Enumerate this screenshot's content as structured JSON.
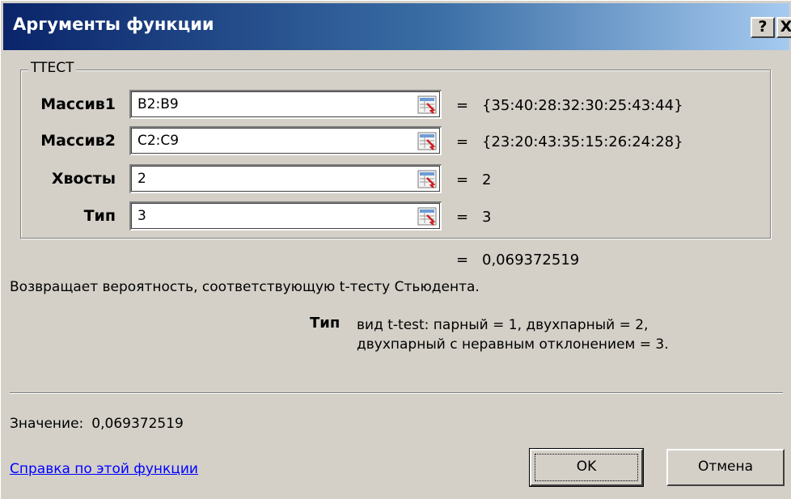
{
  "window": {
    "title": "Аргументы функции",
    "help_label": "?",
    "close_label": "X"
  },
  "function": {
    "name": "TTECT",
    "args": [
      {
        "label": "Массив1",
        "value": "B2:B9",
        "result": "{35:40:28:32:30:25:43:44}"
      },
      {
        "label": "Массив2",
        "value": "C2:C9",
        "result": "{23:20:43:35:15:26:24:28}"
      },
      {
        "label": "Хвосты",
        "value": "2",
        "result": "2"
      },
      {
        "label": "Тип",
        "value": "3",
        "result": "3"
      }
    ],
    "equals": "=",
    "result": "0,069372519",
    "description": "Возвращает вероятность, соответствующую t-тесту Стьюдента."
  },
  "arg_help": {
    "name": "Тип",
    "line1": "вид t-test: парный = 1, двухпарный = 2,",
    "line2": "двухпарный с неравным отклонением = 3."
  },
  "value_line": {
    "label": "Значение:",
    "value": "0,069372519"
  },
  "footer": {
    "help_link": "Справка по этой функции",
    "ok_label": "OK",
    "cancel_label": "Отмена"
  },
  "colors": {
    "title_start": "#0a246a",
    "title_end": "#a6caf0",
    "dialog_bg": "#d4d0c8",
    "link": "#0000ff"
  }
}
